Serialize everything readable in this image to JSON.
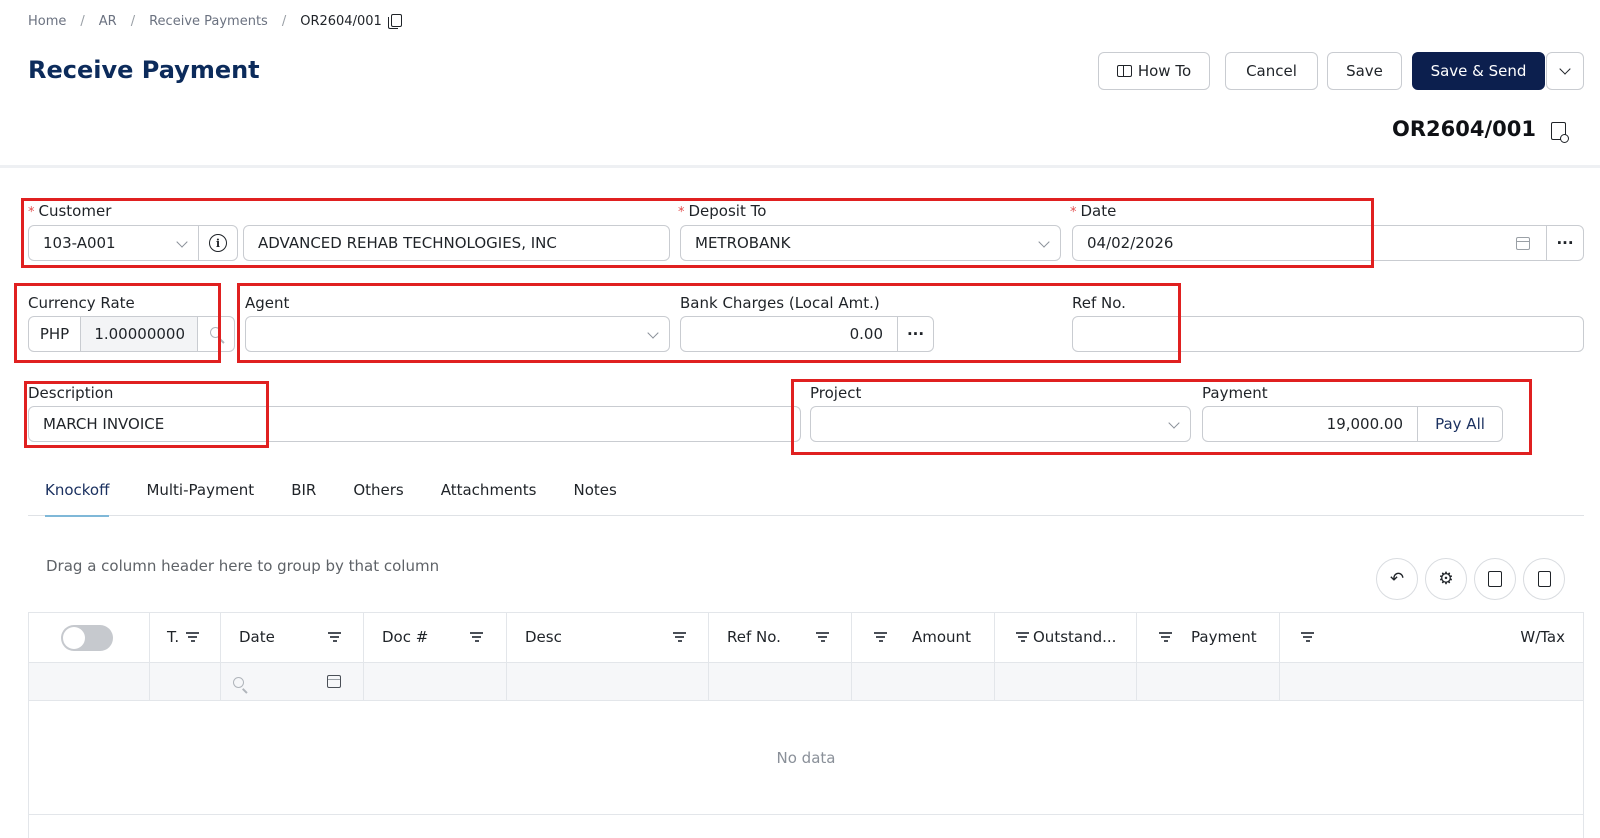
{
  "breadcrumb": {
    "items": [
      "Home",
      "AR",
      "Receive Payments",
      "OR2604/001"
    ],
    "separator": "/"
  },
  "page": {
    "title": "Receive Payment",
    "doc_number": "OR2604/001"
  },
  "toolbar": {
    "how_to": "How To",
    "cancel": "Cancel",
    "save": "Save",
    "save_send": "Save & Send"
  },
  "form": {
    "customer": {
      "label": "Customer",
      "code": "103-A001",
      "name": "ADVANCED REHAB TECHNOLOGIES, INC"
    },
    "deposit_to": {
      "label": "Deposit To",
      "value": "METROBANK"
    },
    "date": {
      "label": "Date",
      "value": "04/02/2026"
    },
    "currency_rate": {
      "label": "Currency Rate",
      "currency": "PHP",
      "rate": "1.00000000"
    },
    "agent": {
      "label": "Agent",
      "value": ""
    },
    "bank_charges": {
      "label": "Bank Charges (Local Amt.)",
      "value": "0.00"
    },
    "ref_no": {
      "label": "Ref No.",
      "value": ""
    },
    "description": {
      "label": "Description",
      "value": "MARCH INVOICE"
    },
    "project": {
      "label": "Project",
      "value": ""
    },
    "payment": {
      "label": "Payment",
      "value": "19,000.00",
      "pay_all": "Pay All"
    },
    "more": "···"
  },
  "tabs": [
    "Knockoff",
    "Multi-Payment",
    "BIR",
    "Others",
    "Attachments",
    "Notes"
  ],
  "grid": {
    "group_hint": "Drag a column header here to group by that column",
    "columns": {
      "type": "T.",
      "date": "Date",
      "doc": "Doc #",
      "desc": "Desc",
      "ref": "Ref No.",
      "amount": "Amount",
      "outstanding": "Outstand...",
      "payment": "Payment",
      "wtax": "W/Tax"
    },
    "empty_text": "No data"
  },
  "colors": {
    "title": "#0c2b5b",
    "primary_button": "#0c1f4e",
    "highlight": "#e02020",
    "required": "#e34d4d"
  }
}
